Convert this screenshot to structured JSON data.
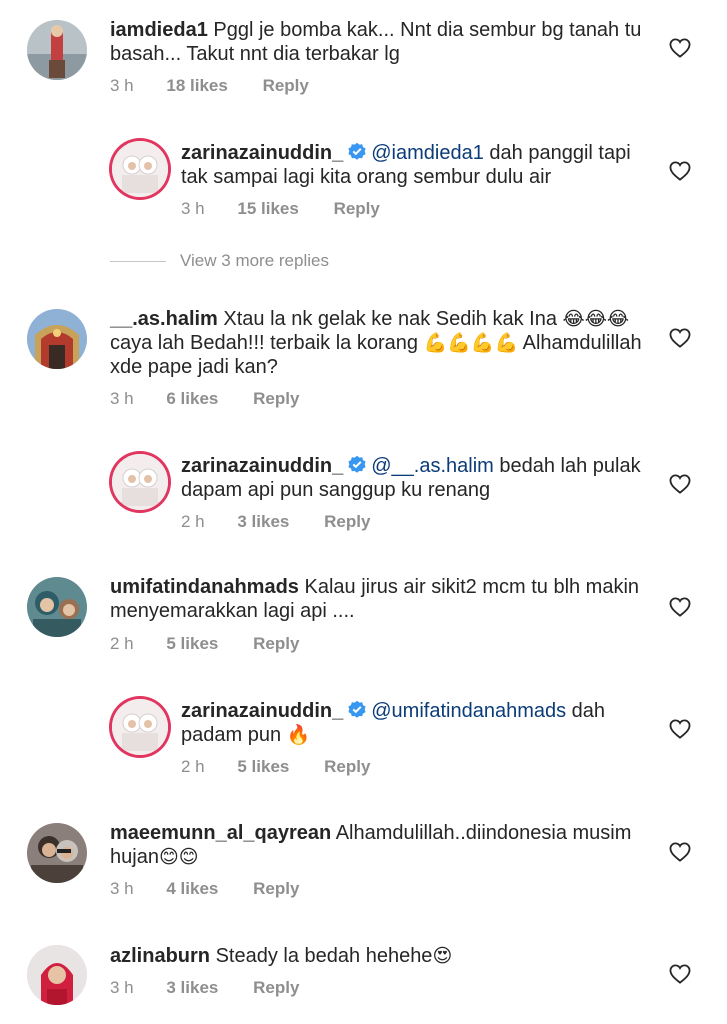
{
  "comments": [
    {
      "username": "iamdieda1",
      "text_line1": "Pggl je bomba kak... Nnt dia sembur bg tanah tu",
      "text_line2": "basah... Takut nnt dia terbakar lg",
      "time": "3 h",
      "likes": "18 likes",
      "reply": "Reply"
    },
    {
      "username": "zarinazainuddin_",
      "mention": "@iamdieda1",
      "text_line1": " dah panggil tapi",
      "text_line2": "tak sampai lagi kita orang sembur dulu air",
      "time": "3 h",
      "likes": "15 likes",
      "reply": "Reply"
    },
    {
      "username": "__.as.halim",
      "text_line1": "Xtau la nk gelak ke nak Sedih kak Ina",
      "emoji_line1": "😂😂😂",
      "text_line2a": "caya lah Bedah!!! terbaik la korang ",
      "emoji_line2": "💪💪💪💪",
      "text_line2b": " Alhamdulillah",
      "text_line3": "xde pape jadi kan?",
      "time": "3 h",
      "likes": "6 likes",
      "reply": "Reply"
    },
    {
      "username": "zarinazainuddin_",
      "mention": "@__.as.halim",
      "text_line1": " bedah lah pulak",
      "text_line2": "dapam api pun sanggup ku renang",
      "time": "2 h",
      "likes": "3 likes",
      "reply": "Reply"
    },
    {
      "username": "umifatindanahmads",
      "text_line1": "Kalau jirus air sikit2 mcm tu blh makin",
      "text_line2": "menyemarakkan lagi api ....",
      "time": "2 h",
      "likes": "5 likes",
      "reply": "Reply"
    },
    {
      "username": "zarinazainuddin_",
      "mention": "@umifatindanahmads",
      "text_line1": " dah",
      "text_line2": "padam pun ",
      "emoji_line2": "🔥",
      "time": "2 h",
      "likes": "5 likes",
      "reply": "Reply"
    },
    {
      "username": "maeemunn_al_qayrean",
      "text_line1": "Alhamdulillah..diindonesia musim",
      "text_line2": "hujan",
      "emoji_line2": "😊😊",
      "time": "3 h",
      "likes": "4 likes",
      "reply": "Reply"
    },
    {
      "username": "azlinaburn",
      "text_line1": "Steady la bedah hehehe",
      "emoji_line1": "😍",
      "time": "3 h",
      "likes": "3 likes",
      "reply": "Reply"
    }
  ],
  "view_more_replies": "View 3 more replies",
  "icons": {
    "heart": "heart-outline-icon",
    "verified": "verified-badge-icon"
  },
  "colors": {
    "meta_gray": "#8e8e8e",
    "mention_blue": "#0b3c79",
    "verified_blue": "#3897f0",
    "story_ring": "#e0365f"
  }
}
